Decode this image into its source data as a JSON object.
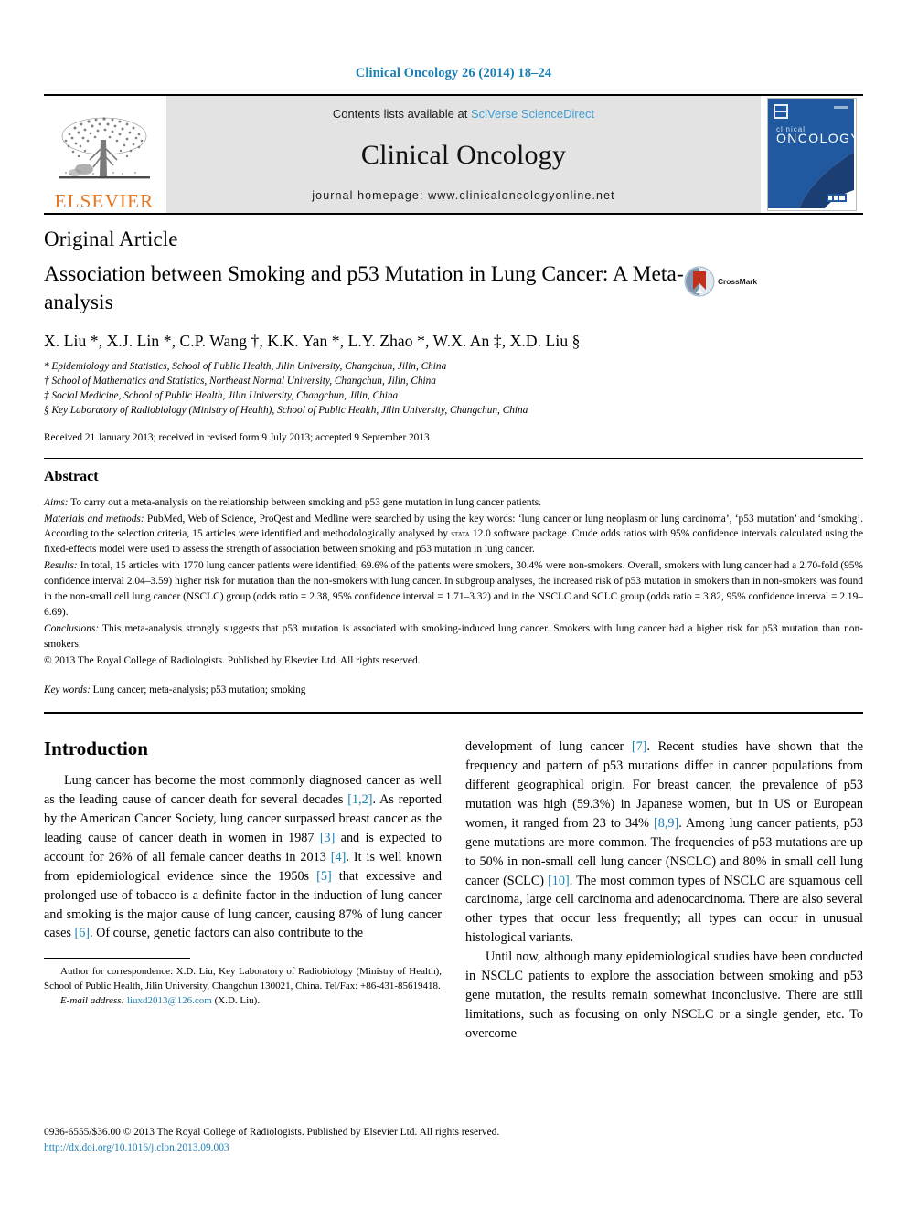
{
  "running_head": "Clinical Oncology 26 (2014) 18–24",
  "masthead": {
    "publisher_name": "ELSEVIER",
    "contents_prefix": "Contents lists available at ",
    "contents_link": "SciVerse ScienceDirect",
    "journal_name": "Clinical Oncology",
    "homepage": "journal homepage: www.clinicaloncologyonline.net",
    "cover_title_small": "clinical",
    "cover_title_large": "ONCOLOGY"
  },
  "article": {
    "type": "Original Article",
    "title": "Association between Smoking and p53 Mutation in Lung Cancer: A Meta-analysis",
    "crossmark_label": "CrossMark",
    "authors": "X. Liu *, X.J. Lin *, C.P. Wang †, K.K. Yan *, L.Y. Zhao *, W.X. An ‡, X.D. Liu §",
    "affiliations": [
      "* Epidemiology and Statistics, School of Public Health, Jilin University, Changchun, Jilin, China",
      "† School of Mathematics and Statistics, Northeast Normal University, Changchun, Jilin, China",
      "‡ Social Medicine, School of Public Health, Jilin University, Changchun, Jilin, China",
      "§ Key Laboratory of Radiobiology (Ministry of Health), School of Public Health, Jilin University, Changchun, China"
    ],
    "history": "Received 21 January 2013; received in revised form 9 July 2013; accepted 9 September 2013"
  },
  "abstract": {
    "heading": "Abstract",
    "aims_label": "Aims:",
    "aims_text": " To carry out a meta-analysis on the relationship between smoking and p53 gene mutation in lung cancer patients.",
    "methods_label": "Materials and methods:",
    "methods_text_1": " PubMed, Web of Science, ProQest and Medline were searched by using the key words: ‘lung cancer or lung neoplasm or lung carcinoma’, ‘p53 mutation’ and ‘smoking’. According to the selection criteria, 15 articles were identified and methodologically analysed by ",
    "methods_software": "stata",
    "methods_text_2": " 12.0 software package. Crude odds ratios with 95% confidence intervals calculated using the fixed-effects model were used to assess the strength of association between smoking and p53 mutation in lung cancer.",
    "results_label": "Results:",
    "results_text": " In total, 15 articles with 1770 lung cancer patients were identified; 69.6% of the patients were smokers, 30.4% were non-smokers. Overall, smokers with lung cancer had a 2.70-fold (95% confidence interval 2.04–3.59) higher risk for mutation than the non-smokers with lung cancer. In subgroup analyses, the increased risk of p53 mutation in smokers than in non-smokers was found in the non-small cell lung cancer (NSCLC) group (odds ratio = 2.38, 95% confidence interval = 1.71–3.32) and in the NSCLC and SCLC group (odds ratio = 3.82, 95% confidence interval = 2.19–6.69).",
    "conclusions_label": "Conclusions:",
    "conclusions_text": " This meta-analysis strongly suggests that p53 mutation is associated with smoking-induced lung cancer. Smokers with lung cancer had a higher risk for p53 mutation than non-smokers.",
    "copyright": "© 2013 The Royal College of Radiologists. Published by Elsevier Ltd. All rights reserved.",
    "keywords_label": "Key words:",
    "keywords_text": " Lung cancer; meta-analysis; p53 mutation; smoking"
  },
  "introduction": {
    "heading": "Introduction",
    "left_para_1_a": "Lung cancer has become the most commonly diagnosed cancer as well as the leading cause of cancer death for several decades ",
    "left_ref_1": "[1,2]",
    "left_para_1_b": ". As reported by the American Cancer Society, lung cancer surpassed breast cancer as the leading cause of cancer death in women in 1987 ",
    "left_ref_2": "[3]",
    "left_para_1_c": " and is expected to account for 26% of all female cancer deaths in 2013 ",
    "left_ref_3": "[4]",
    "left_para_1_d": ". It is well known from epidemiological evidence since the 1950s ",
    "left_ref_4": "[5]",
    "left_para_1_e": " that excessive and prolonged use of tobacco is a definite factor in the induction of lung cancer and smoking is the major cause of lung cancer, causing 87% of lung cancer cases ",
    "left_ref_5": "[6]",
    "left_para_1_f": ". Of course, genetic factors can also contribute to the",
    "right_para_1_a": "development of lung cancer ",
    "right_ref_1": "[7]",
    "right_para_1_b": ". Recent studies have shown that the frequency and pattern of p53 mutations differ in cancer populations from different geographical origin. For breast cancer, the prevalence of p53 mutation was high (59.3%) in Japanese women, but in US or European women, it ranged from 23 to 34% ",
    "right_ref_2": "[8,9]",
    "right_para_1_c": ". Among lung cancer patients, p53 gene mutations are more common. The frequencies of p53 mutations are up to 50% in non-small cell lung cancer (NSCLC) and 80% in small cell lung cancer (SCLC) ",
    "right_ref_3": "[10]",
    "right_para_1_d": ". The most common types of NSCLC are squamous cell carcinoma, large cell carcinoma and adenocarcinoma. There are also several other types that occur less frequently; all types can occur in unusual histological variants.",
    "right_para_2": "Until now, although many epidemiological studies have been conducted in NSCLC patients to explore the association between smoking and p53 gene mutation, the results remain somewhat inconclusive. There are still limitations, such as focusing on only NSCLC or a single gender, etc. To overcome"
  },
  "footnote": {
    "correspondence": "Author for correspondence: X.D. Liu, Key Laboratory of Radiobiology (Ministry of Health), School of Public Health, Jilin University, Changchun 130021, China. Tel/Fax: +86-431-85619418.",
    "email_label": "E-mail address:",
    "email": "liuxd2013@126.com",
    "email_suffix": " (X.D. Liu)."
  },
  "footer": {
    "issn_line": "0936-6555/$36.00 © 2013 The Royal College of Radiologists. Published by Elsevier Ltd. All rights reserved.",
    "doi": "http://dx.doi.org/10.1016/j.clon.2013.09.003"
  },
  "colors": {
    "link_blue": "#1b7fb5",
    "sciencedirect_blue": "#3d9fd6",
    "elsevier_orange": "#E87722",
    "band_gray": "#e3e3e3",
    "cover_blue": "#1c4c8f"
  }
}
